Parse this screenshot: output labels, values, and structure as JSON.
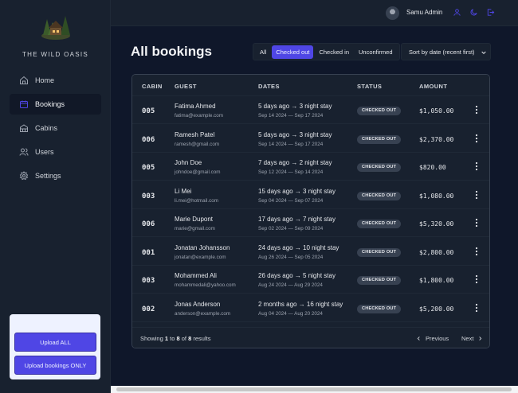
{
  "app": {
    "brand": "THE WILD OASIS",
    "user_name": "Samu Admin"
  },
  "sidebar": {
    "items": [
      {
        "label": "Home",
        "icon": "home-icon",
        "active": false
      },
      {
        "label": "Bookings",
        "icon": "calendar-icon",
        "active": true
      },
      {
        "label": "Cabins",
        "icon": "cabin-icon",
        "active": false
      },
      {
        "label": "Users",
        "icon": "users-icon",
        "active": false
      },
      {
        "label": "Settings",
        "icon": "gear-icon",
        "active": false
      }
    ],
    "upload_all": "Upload ALL",
    "upload_bookings": "Upload bookings ONLY"
  },
  "page": {
    "title": "All bookings"
  },
  "filter": {
    "options": [
      "All",
      "Checked out",
      "Checked in",
      "Unconfirmed"
    ],
    "selected": "Checked out"
  },
  "sort": {
    "selected": "Sort by date (recent first)"
  },
  "table": {
    "headers": [
      "CABIN",
      "GUEST",
      "DATES",
      "STATUS",
      "AMOUNT"
    ],
    "rows": [
      {
        "cabin": "005",
        "guest": "Fatima Ahmed",
        "email": "fatima@example.com",
        "relative": "5 days ago → 3 night stay",
        "range": "Sep 14 2024 — Sep 17 2024",
        "status": "CHECKED OUT",
        "amount": "$1,050.00"
      },
      {
        "cabin": "006",
        "guest": "Ramesh Patel",
        "email": "ramesh@gmail.com",
        "relative": "5 days ago → 3 night stay",
        "range": "Sep 14 2024 — Sep 17 2024",
        "status": "CHECKED OUT",
        "amount": "$2,370.00"
      },
      {
        "cabin": "005",
        "guest": "John Doe",
        "email": "johndoe@gmail.com",
        "relative": "7 days ago → 2 night stay",
        "range": "Sep 12 2024 — Sep 14 2024",
        "status": "CHECKED OUT",
        "amount": "$820.00"
      },
      {
        "cabin": "003",
        "guest": "Li Mei",
        "email": "li.mei@hotmail.com",
        "relative": "15 days ago → 3 night stay",
        "range": "Sep 04 2024 — Sep 07 2024",
        "status": "CHECKED OUT",
        "amount": "$1,080.00"
      },
      {
        "cabin": "006",
        "guest": "Marie Dupont",
        "email": "marie@gmail.com",
        "relative": "17 days ago → 7 night stay",
        "range": "Sep 02 2024 — Sep 09 2024",
        "status": "CHECKED OUT",
        "amount": "$5,320.00"
      },
      {
        "cabin": "001",
        "guest": "Jonatan Johansson",
        "email": "jonatan@example.com",
        "relative": "24 days ago → 10 night stay",
        "range": "Aug 26 2024 — Sep 05 2024",
        "status": "CHECKED OUT",
        "amount": "$2,800.00"
      },
      {
        "cabin": "003",
        "guest": "Mohammed Ali",
        "email": "mohammedali@yahoo.com",
        "relative": "26 days ago → 5 night stay",
        "range": "Aug 24 2024 — Aug 29 2024",
        "status": "CHECKED OUT",
        "amount": "$1,800.00"
      },
      {
        "cabin": "002",
        "guest": "Jonas Anderson",
        "email": "anderson@example.com",
        "relative": "2 months ago → 16 night stay",
        "range": "Aug 04 2024 — Aug 20 2024",
        "status": "CHECKED OUT",
        "amount": "$5,200.00"
      }
    ]
  },
  "pagination": {
    "prefix": "Showing",
    "from": "1",
    "to_word": "to",
    "to": "8",
    "of_word": "of",
    "total": "8",
    "suffix": "results",
    "prev_label": "Previous",
    "next_label": "Next"
  },
  "colors": {
    "accent": "#4f46e5",
    "background": "#0f172a",
    "panel": "#18212f"
  }
}
